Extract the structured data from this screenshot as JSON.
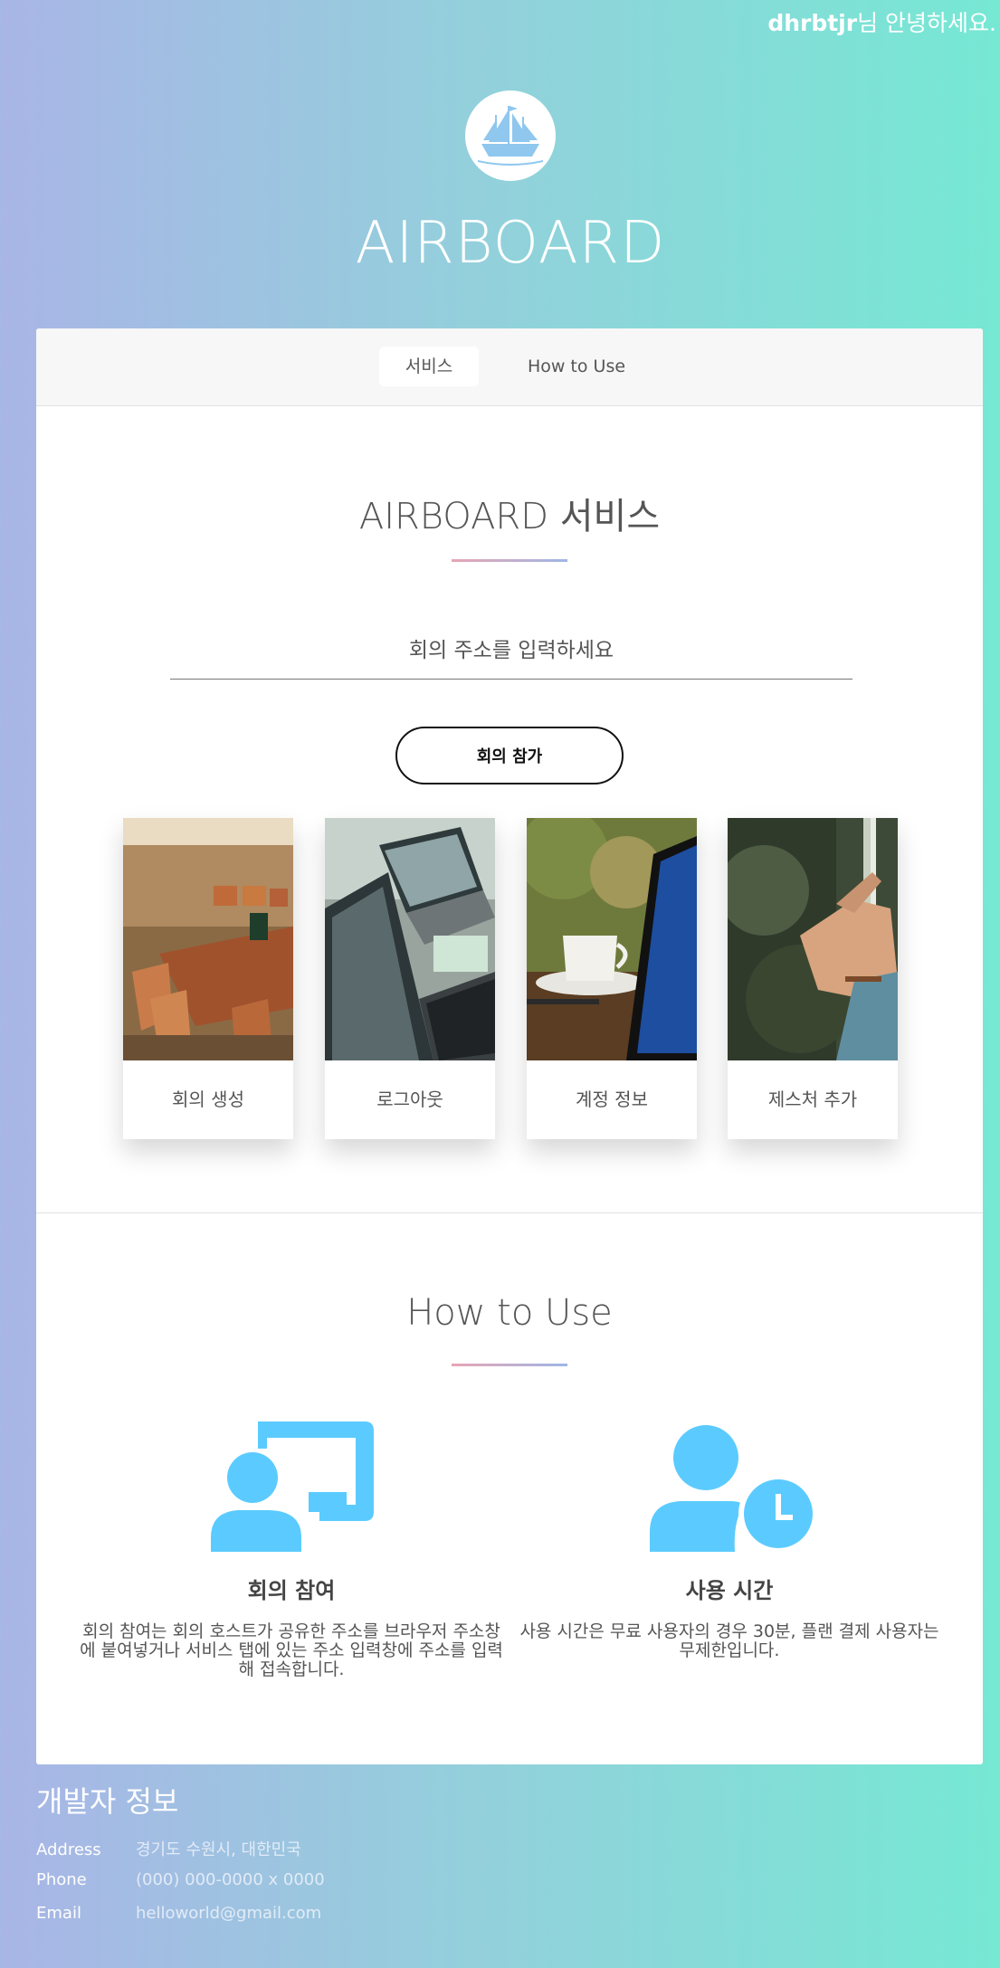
{
  "header": {
    "username": "dhrbtjr",
    "greeting_suffix": "님 안녕하세요.",
    "brand": "AIRBOARD"
  },
  "tabs": [
    {
      "label": "서비스",
      "active": true
    },
    {
      "label": "How to Use",
      "active": false
    }
  ],
  "service": {
    "title": "AIRBOARD 서비스",
    "address_placeholder": "회의 주소를 입력하세요",
    "join_button": "회의 참가",
    "tiles": [
      {
        "label": "회의 생성",
        "image": "meeting-room-photo"
      },
      {
        "label": "로그아웃",
        "image": "laptop-desk-photo"
      },
      {
        "label": "계정 정보",
        "image": "coffee-cup-tablet-photo"
      },
      {
        "label": "제스처 추가",
        "image": "hand-waterfall-photo"
      }
    ]
  },
  "how_to_use": {
    "title": "How to Use",
    "features": [
      {
        "icon": "presenter-icon",
        "title": "회의 참여",
        "description": "회의 참여는 회의 호스트가 공유한 주소를 브라우저 주소창에 붙여넣거나 서비스 탭에 있는 주소 입력창에 주소를 입력해 접속합니다."
      },
      {
        "icon": "user-clock-icon",
        "title": "사용 시간",
        "description": "사용 시간은 무료 사용자의 경우 30분, 플랜 결제 사용자는 무제한입니다."
      }
    ]
  },
  "footer": {
    "title": "개발자 정보",
    "rows": [
      {
        "key": "Address",
        "value": "경기도 수원시, 대한민국"
      },
      {
        "key": "Phone",
        "value": "(000) 000-0000 x 0000"
      },
      {
        "key": "Email",
        "value": "helloworld@gmail.com"
      }
    ]
  },
  "colors": {
    "accent_icon": "#5bcbff",
    "gradient_start": "#a9b5e6",
    "gradient_end": "#76e8d4"
  }
}
